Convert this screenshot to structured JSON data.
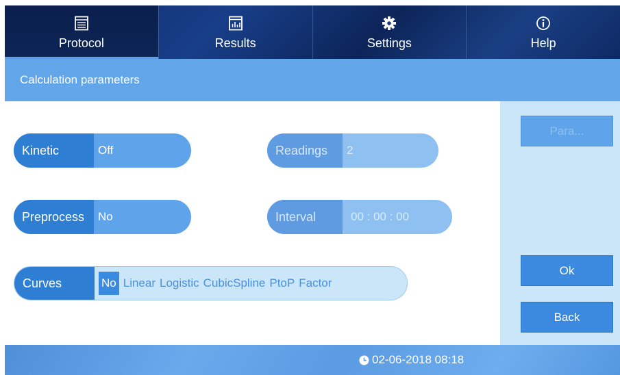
{
  "nav": {
    "tabs": [
      {
        "label": "Protocol",
        "icon": "window-icon"
      },
      {
        "label": "Results",
        "icon": "bar-chart-icon"
      },
      {
        "label": "Settings",
        "icon": "gear-icon"
      },
      {
        "label": "Help",
        "icon": "info-icon"
      }
    ],
    "active_tab": "Protocol"
  },
  "header": {
    "title": "Calculation parameters"
  },
  "fields": {
    "kinetic": {
      "label": "Kinetic",
      "value": "Off"
    },
    "preprocess": {
      "label": "Preprocess",
      "value": "No"
    },
    "readings": {
      "label": "Readings",
      "value": "2"
    },
    "interval": {
      "label": "Interval",
      "value": "00 : 00 : 00"
    },
    "curves": {
      "label": "Curves",
      "options": [
        "No",
        "Linear",
        "Logistic",
        "CubicSpline",
        "PtoP",
        "Factor"
      ],
      "selected": "No"
    }
  },
  "buttons": {
    "para": "Para...",
    "ok": "Ok",
    "back": "Back"
  },
  "footer": {
    "datetime": "02-06-2018 08:18"
  },
  "colors": {
    "nav_bg": "#0f2b66",
    "header_bg": "#62a5e9",
    "accent": "#2e7fd3",
    "side_bg": "#cbe6f8"
  }
}
